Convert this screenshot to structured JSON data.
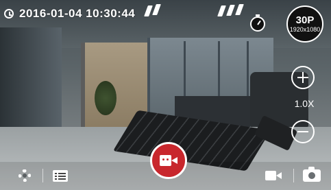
{
  "camera_overlay": {
    "timestamp": "2016-01-04 10:30:44",
    "resolution_badge": {
      "fps": "30P",
      "size": "1920x1080"
    },
    "zoom": {
      "level": "1.0X"
    }
  },
  "bottom_bar": {
    "icons": [
      "gear-icon",
      "list-icon",
      "video-mode-icon",
      "camera-icon"
    ]
  },
  "colors": {
    "record": "#c8272d",
    "foreground": "#ffffff"
  }
}
